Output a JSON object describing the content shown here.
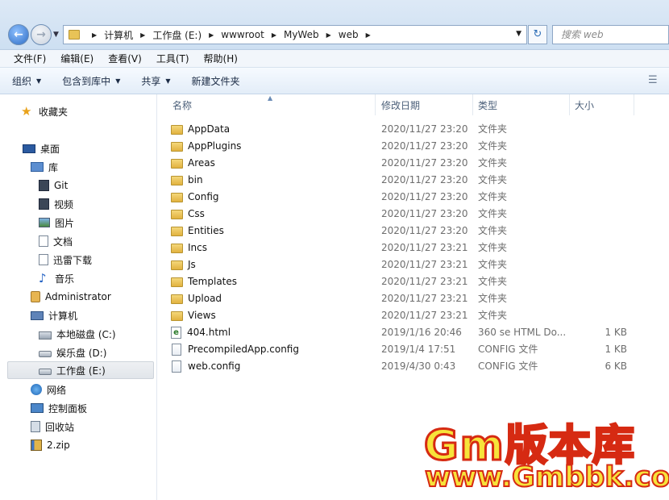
{
  "address": {
    "crumbs": [
      "计算机",
      "工作盘 (E:)",
      "wwwroot",
      "MyWeb",
      "web"
    ],
    "search_placeholder": "搜索 web"
  },
  "menu": [
    "文件(F)",
    "编辑(E)",
    "查看(V)",
    "工具(T)",
    "帮助(H)"
  ],
  "toolbar": {
    "organize": "组织",
    "include_library": "包含到库中",
    "share": "共享",
    "new_folder": "新建文件夹"
  },
  "sidebar": {
    "favorites": "收藏夹",
    "desktop": "桌面",
    "library": "库",
    "lib_items": [
      "Git",
      "视频",
      "图片",
      "文档",
      "迅雷下载",
      "音乐"
    ],
    "user": "Administrator",
    "computer": "计算机",
    "drives": [
      "本地磁盘 (C:)",
      "娱乐盘 (D:)",
      "工作盘 (E:)"
    ],
    "network": "网络",
    "control_panel": "控制面板",
    "recycle_bin": "回收站",
    "zip": "2.zip"
  },
  "columns": {
    "name": "名称",
    "date": "修改日期",
    "type": "类型",
    "size": "大小"
  },
  "files": [
    {
      "name": "AppData",
      "date": "2020/11/27 23:20",
      "type": "文件夹",
      "size": "",
      "kind": "folder"
    },
    {
      "name": "AppPlugins",
      "date": "2020/11/27 23:20",
      "type": "文件夹",
      "size": "",
      "kind": "folder"
    },
    {
      "name": "Areas",
      "date": "2020/11/27 23:20",
      "type": "文件夹",
      "size": "",
      "kind": "folder"
    },
    {
      "name": "bin",
      "date": "2020/11/27 23:20",
      "type": "文件夹",
      "size": "",
      "kind": "folder"
    },
    {
      "name": "Config",
      "date": "2020/11/27 23:20",
      "type": "文件夹",
      "size": "",
      "kind": "folder"
    },
    {
      "name": "Css",
      "date": "2020/11/27 23:20",
      "type": "文件夹",
      "size": "",
      "kind": "folder"
    },
    {
      "name": "Entities",
      "date": "2020/11/27 23:20",
      "type": "文件夹",
      "size": "",
      "kind": "folder"
    },
    {
      "name": "Incs",
      "date": "2020/11/27 23:21",
      "type": "文件夹",
      "size": "",
      "kind": "folder"
    },
    {
      "name": "Js",
      "date": "2020/11/27 23:21",
      "type": "文件夹",
      "size": "",
      "kind": "folder"
    },
    {
      "name": "Templates",
      "date": "2020/11/27 23:21",
      "type": "文件夹",
      "size": "",
      "kind": "folder"
    },
    {
      "name": "Upload",
      "date": "2020/11/27 23:21",
      "type": "文件夹",
      "size": "",
      "kind": "folder"
    },
    {
      "name": "Views",
      "date": "2020/11/27 23:21",
      "type": "文件夹",
      "size": "",
      "kind": "folder"
    },
    {
      "name": "404.html",
      "date": "2019/1/16 20:46",
      "type": "360 se HTML Do...",
      "size": "1 KB",
      "kind": "html"
    },
    {
      "name": "PrecompiledApp.config",
      "date": "2019/1/4 17:51",
      "type": "CONFIG 文件",
      "size": "1 KB",
      "kind": "config"
    },
    {
      "name": "web.config",
      "date": "2019/4/30 0:43",
      "type": "CONFIG 文件",
      "size": "6 KB",
      "kind": "config"
    }
  ],
  "watermark": {
    "line1": "Gm版本库",
    "line2": "www.Gmbbk.com"
  }
}
